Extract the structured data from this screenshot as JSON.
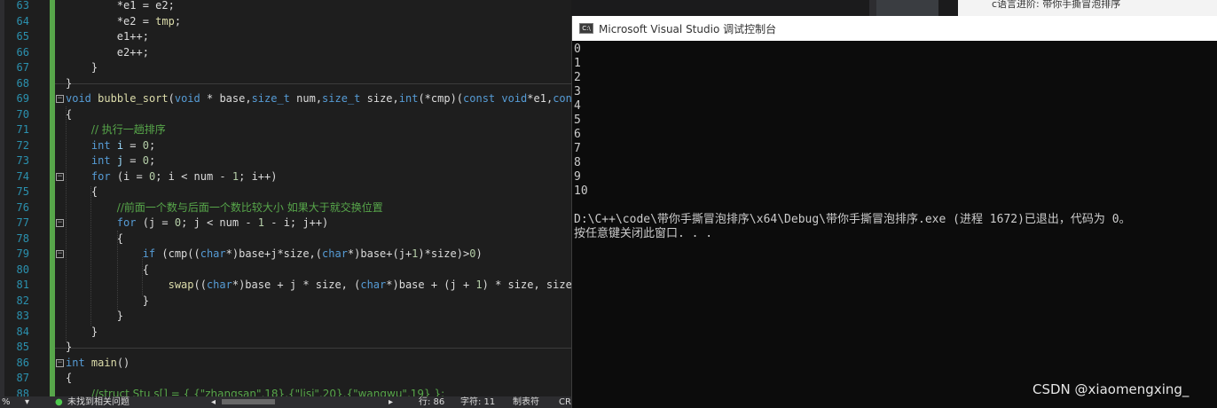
{
  "editor": {
    "lines": [
      {
        "n": "63",
        "segs": [
          [
            "",
            "        *e1 = e2;"
          ]
        ]
      },
      {
        "n": "64",
        "segs": [
          [
            "",
            "        *e2 = "
          ],
          [
            "fn",
            "tmp"
          ],
          [
            "",
            ";"
          ]
        ]
      },
      {
        "n": "65",
        "segs": [
          [
            "",
            "        e1++;"
          ]
        ]
      },
      {
        "n": "66",
        "segs": [
          [
            "",
            "        e2++;"
          ]
        ]
      },
      {
        "n": "67",
        "segs": [
          [
            "",
            "    }"
          ]
        ]
      },
      {
        "n": "68",
        "segs": [
          [
            "",
            "}"
          ]
        ]
      },
      {
        "n": "69",
        "fold": "-",
        "segs": [
          [
            "kw",
            "void"
          ],
          [
            "",
            " "
          ],
          [
            "fn",
            "bubble_sort"
          ],
          [
            "",
            "("
          ],
          [
            "kw",
            "void"
          ],
          [
            "",
            " * base,"
          ],
          [
            "kw",
            "size_t"
          ],
          [
            "",
            " num,"
          ],
          [
            "kw",
            "size_t"
          ],
          [
            "",
            " size,"
          ],
          [
            "kw",
            "int"
          ],
          [
            "",
            "(*cmp)("
          ],
          [
            "kw",
            "const void"
          ],
          [
            "",
            "*e1,"
          ],
          [
            "kw",
            "cons"
          ]
        ]
      },
      {
        "n": "70",
        "segs": [
          [
            "",
            "{"
          ]
        ]
      },
      {
        "n": "71",
        "segs": [
          [
            "",
            "    "
          ],
          [
            "cm",
            "// 执行一趟排序"
          ]
        ]
      },
      {
        "n": "72",
        "segs": [
          [
            "",
            "    "
          ],
          [
            "kw",
            "int"
          ],
          [
            "",
            " "
          ],
          [
            "vr",
            "i"
          ],
          [
            "",
            " = "
          ],
          [
            "nm",
            "0"
          ],
          [
            "",
            ";"
          ]
        ]
      },
      {
        "n": "73",
        "segs": [
          [
            "",
            "    "
          ],
          [
            "kw",
            "int"
          ],
          [
            "",
            " "
          ],
          [
            "vr",
            "j"
          ],
          [
            "",
            " = "
          ],
          [
            "nm",
            "0"
          ],
          [
            "",
            ";"
          ]
        ]
      },
      {
        "n": "74",
        "fold": "-",
        "segs": [
          [
            "",
            "    "
          ],
          [
            "kw",
            "for"
          ],
          [
            "",
            " (i = "
          ],
          [
            "nm",
            "0"
          ],
          [
            "",
            "; i < num - "
          ],
          [
            "nm",
            "1"
          ],
          [
            "",
            "; i++)"
          ]
        ]
      },
      {
        "n": "75",
        "segs": [
          [
            "",
            "    {"
          ]
        ]
      },
      {
        "n": "76",
        "segs": [
          [
            "",
            "        "
          ],
          [
            "cm",
            "//前面一个数与后面一个数比较大小 如果大于就交换位置"
          ]
        ]
      },
      {
        "n": "77",
        "fold": "-",
        "segs": [
          [
            "",
            "        "
          ],
          [
            "kw",
            "for"
          ],
          [
            "",
            " (j = "
          ],
          [
            "nm",
            "0"
          ],
          [
            "",
            "; j < num - "
          ],
          [
            "nm",
            "1"
          ],
          [
            "",
            " - i; j++)"
          ]
        ]
      },
      {
        "n": "78",
        "segs": [
          [
            "",
            "        {"
          ]
        ]
      },
      {
        "n": "79",
        "fold": "-",
        "segs": [
          [
            "",
            "            "
          ],
          [
            "kw",
            "if"
          ],
          [
            "",
            " (cmp(("
          ],
          [
            "kw",
            "char"
          ],
          [
            "",
            "*)base+j*size,("
          ],
          [
            "kw",
            "char"
          ],
          [
            "",
            "*)base+(j+"
          ],
          [
            "nm",
            "1"
          ],
          [
            "",
            ")*size)>"
          ],
          [
            "nm",
            "0"
          ],
          [
            "",
            ")"
          ]
        ]
      },
      {
        "n": "80",
        "segs": [
          [
            "",
            "            {"
          ]
        ]
      },
      {
        "n": "81",
        "segs": [
          [
            "",
            "                "
          ],
          [
            "fn",
            "swap"
          ],
          [
            "",
            "(("
          ],
          [
            "kw",
            "char"
          ],
          [
            "",
            "*)base + j * size, ("
          ],
          [
            "kw",
            "char"
          ],
          [
            "",
            "*)base + (j + "
          ],
          [
            "nm",
            "1"
          ],
          [
            "",
            ") * size, size)"
          ]
        ]
      },
      {
        "n": "82",
        "segs": [
          [
            "",
            "            }"
          ]
        ]
      },
      {
        "n": "83",
        "segs": [
          [
            "",
            "        }"
          ]
        ]
      },
      {
        "n": "84",
        "segs": [
          [
            "",
            "    }"
          ]
        ]
      },
      {
        "n": "85",
        "segs": [
          [
            "",
            "}"
          ]
        ]
      },
      {
        "n": "86",
        "fold": "-",
        "segs": [
          [
            "kw",
            "int"
          ],
          [
            "",
            " "
          ],
          [
            "fn",
            "main"
          ],
          [
            "",
            "()"
          ]
        ]
      },
      {
        "n": "87",
        "segs": [
          [
            "",
            "{"
          ]
        ]
      },
      {
        "n": "88",
        "segs": [
          [
            "",
            "    "
          ],
          [
            "cm",
            "//struct Stu s[] = { {\"zhangsan\",18},{\"lisi\",20},{\"wangwu\",19} };"
          ]
        ]
      }
    ]
  },
  "statusbar": {
    "zoom": "%",
    "issues_icon": "check-circle-icon",
    "issues": "未找到相关问题",
    "line": "行: 86",
    "char": "字符: 11",
    "tabs": "制表符",
    "eol": "CR"
  },
  "background": {
    "article_title": "c语言进阶: 带你手撕冒泡排序"
  },
  "console": {
    "title": "Microsoft Visual Studio 调试控制台",
    "icon_label": "C:\\",
    "output": [
      "0",
      "1",
      "2",
      "3",
      "4",
      "5",
      "6",
      "7",
      "8",
      "9",
      "10",
      "",
      "D:\\C++\\code\\带你手撕冒泡排序\\x64\\Debug\\带你手撕冒泡排序.exe (进程 1672)已退出，代码为 0。",
      "按任意键关闭此窗口. . ."
    ]
  },
  "watermark": "CSDN @xiaomengxing_"
}
